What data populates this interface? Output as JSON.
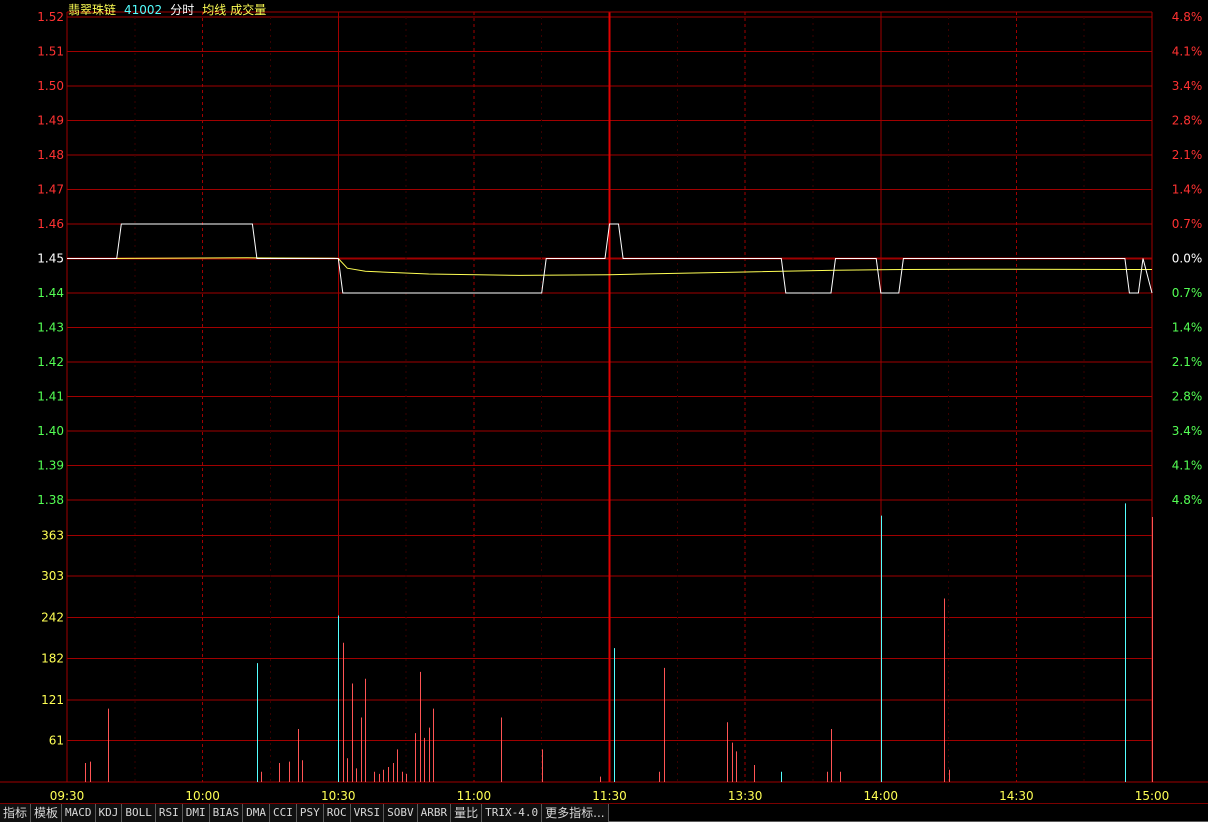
{
  "header": {
    "stock_name": "翡翠珠链",
    "stock_code": "41002",
    "mode_label": "分时",
    "avg_label": "均线",
    "volume_label": "成交量"
  },
  "colors": {
    "up": "#ff3232",
    "down": "#54ff54",
    "neutral": "#ffffff",
    "grid": "#a00000",
    "price_line": "#ffffff",
    "avg_line": "#ffff54",
    "vol_up": "#ff5454",
    "vol_down": "#54ffff",
    "volume_axis": "#ffff54"
  },
  "toolbar": {
    "tabs": [
      "指标",
      "模板",
      "MACD",
      "KDJ",
      "BOLL",
      "RSI",
      "DMI",
      "BIAS",
      "DMA",
      "CCI",
      "PSY",
      "ROC",
      "VRSI",
      "SOBV",
      "ARBR",
      "量比",
      "TRIX-4.0",
      "更多指标..."
    ]
  },
  "chart_data": {
    "type": "line",
    "title": "",
    "prev_close": 1.45,
    "price_axis": {
      "ticks": [
        "1.52",
        "1.51",
        "1.50",
        "1.49",
        "1.48",
        "1.47",
        "1.46",
        "1.45",
        "1.44",
        "1.43",
        "1.42",
        "1.41",
        "1.40",
        "1.39",
        "1.38"
      ],
      "ylim": [
        1.38,
        1.52
      ]
    },
    "percent_axis": {
      "ticks": [
        "4.8%",
        "4.1%",
        "3.4%",
        "2.8%",
        "2.1%",
        "1.4%",
        "0.7%",
        "0.0%",
        "0.7%",
        "1.4%",
        "2.1%",
        "2.8%",
        "3.4%",
        "4.1%",
        "4.8%"
      ]
    },
    "time_axis": {
      "ticks": [
        "09:30",
        "10:00",
        "10:30",
        "11:00",
        "11:30",
        "13:30",
        "14:00",
        "14:30",
        "15:00"
      ],
      "minutes": 240
    },
    "volume_axis": {
      "ticks": [
        "363",
        "303",
        "242",
        "182",
        "121",
        "61"
      ],
      "ylim": [
        0,
        415
      ]
    },
    "series": [
      {
        "name": "分时",
        "points": [
          [
            0,
            1.45
          ],
          [
            11,
            1.45
          ],
          [
            12,
            1.46
          ],
          [
            41,
            1.46
          ],
          [
            42,
            1.45
          ],
          [
            60,
            1.45
          ],
          [
            61,
            1.44
          ],
          [
            105,
            1.44
          ],
          [
            106,
            1.45
          ],
          [
            119,
            1.45
          ],
          [
            120,
            1.46
          ],
          [
            122,
            1.46
          ],
          [
            123,
            1.45
          ],
          [
            158,
            1.45
          ],
          [
            159,
            1.44
          ],
          [
            169,
            1.44
          ],
          [
            170,
            1.45
          ],
          [
            179,
            1.45
          ],
          [
            180,
            1.44
          ],
          [
            184,
            1.44
          ],
          [
            185,
            1.45
          ],
          [
            234,
            1.45
          ],
          [
            235,
            1.44
          ],
          [
            237,
            1.44
          ],
          [
            238,
            1.45
          ],
          [
            240,
            1.44
          ]
        ]
      },
      {
        "name": "均线",
        "points": [
          [
            0,
            1.45
          ],
          [
            10,
            1.45
          ],
          [
            20,
            1.4501
          ],
          [
            40,
            1.4502
          ],
          [
            59,
            1.4501
          ],
          [
            60,
            1.45
          ],
          [
            62,
            1.4472
          ],
          [
            66,
            1.4463
          ],
          [
            80,
            1.4455
          ],
          [
            100,
            1.4451
          ],
          [
            120,
            1.4453
          ],
          [
            130,
            1.4456
          ],
          [
            150,
            1.4461
          ],
          [
            170,
            1.4466
          ],
          [
            185,
            1.4468
          ],
          [
            200,
            1.4469
          ],
          [
            235,
            1.4468
          ],
          [
            240,
            1.4468
          ]
        ]
      }
    ],
    "volume": [
      [
        4,
        28,
        "up"
      ],
      [
        5,
        30,
        "up"
      ],
      [
        9,
        108,
        "up"
      ],
      [
        42,
        175,
        "down"
      ],
      [
        43,
        15,
        "up"
      ],
      [
        47,
        28,
        "up"
      ],
      [
        49,
        30,
        "up"
      ],
      [
        51,
        78,
        "up"
      ],
      [
        52,
        32,
        "up"
      ],
      [
        60,
        245,
        "down"
      ],
      [
        61,
        205,
        "up"
      ],
      [
        62,
        35,
        "up"
      ],
      [
        63,
        145,
        "up"
      ],
      [
        64,
        20,
        "up"
      ],
      [
        65,
        95,
        "up"
      ],
      [
        66,
        152,
        "up"
      ],
      [
        68,
        15,
        "up"
      ],
      [
        69,
        12,
        "up"
      ],
      [
        70,
        18,
        "up"
      ],
      [
        71,
        22,
        "up"
      ],
      [
        72,
        28,
        "up"
      ],
      [
        73,
        48,
        "up"
      ],
      [
        74,
        15,
        "up"
      ],
      [
        75,
        12,
        "up"
      ],
      [
        77,
        72,
        "up"
      ],
      [
        78,
        162,
        "up"
      ],
      [
        79,
        65,
        "up"
      ],
      [
        80,
        80,
        "up"
      ],
      [
        81,
        108,
        "up"
      ],
      [
        96,
        95,
        "up"
      ],
      [
        105,
        48,
        "up"
      ],
      [
        118,
        8,
        "up"
      ],
      [
        121,
        197,
        "down"
      ],
      [
        131,
        15,
        "up"
      ],
      [
        132,
        168,
        "up"
      ],
      [
        146,
        88,
        "up"
      ],
      [
        147,
        58,
        "up"
      ],
      [
        148,
        45,
        "up"
      ],
      [
        152,
        25,
        "up"
      ],
      [
        158,
        15,
        "down"
      ],
      [
        168,
        15,
        "up"
      ],
      [
        169,
        78,
        "up"
      ],
      [
        171,
        15,
        "up"
      ],
      [
        180,
        392,
        "down"
      ],
      [
        194,
        270,
        "up"
      ],
      [
        195,
        18,
        "up"
      ],
      [
        234,
        410,
        "down"
      ],
      [
        240,
        390,
        "up"
      ]
    ]
  }
}
